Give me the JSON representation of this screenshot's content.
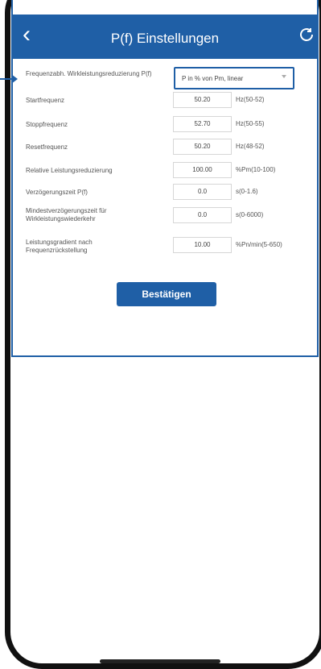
{
  "header": {
    "back_icon": "chevron-left-icon",
    "title": "P(f) Einstellungen",
    "refresh_icon": "refresh-icon"
  },
  "form": {
    "frequency_reduction": {
      "label": "Frequenzabh. Wirkleistungsreduzierung P(f)",
      "selected": "P in % von Pm, linear"
    },
    "start_frequency": {
      "label": "Startfrequenz",
      "value": "50.20",
      "range": "Hz(50-52)"
    },
    "stop_frequency": {
      "label": "Stoppfrequenz",
      "value": "52.70",
      "range": "Hz(50-55)"
    },
    "reset_frequency": {
      "label": "Resetfrequenz",
      "value": "50.20",
      "range": "Hz(48-52)"
    },
    "relative_reduction": {
      "label": "Relative Leistungsreduzierung",
      "value": "100.00",
      "range": "%Pm(10-100)"
    },
    "delay_time": {
      "label": "Verzögerungszeit P(f)",
      "value": "0.0",
      "range": "s(0-1.6)"
    },
    "min_delay_time": {
      "label": "Mindestverzögerungszeit für Wirkleistungswiederkehr",
      "value": "0.0",
      "range": "s(0-6000)"
    },
    "power_gradient": {
      "label": "Leistungsgradient nach Frequenzrückstellung",
      "value": "10.00",
      "range": "%Pn/min(5-650)"
    }
  },
  "confirm_label": "Bestätigen",
  "colors": {
    "primary": "#1f5fa6"
  }
}
